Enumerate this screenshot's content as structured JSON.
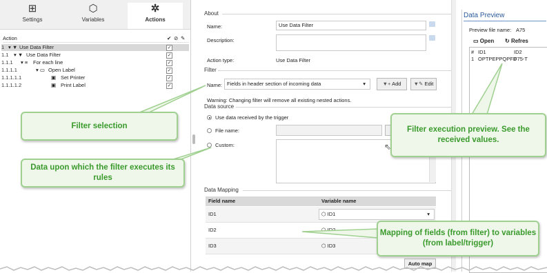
{
  "tabs": {
    "settings": "Settings",
    "variables": "Variables",
    "actions": "Actions"
  },
  "tree": {
    "header": "Action",
    "header_icons": [
      "✔",
      "⊘",
      "✎"
    ],
    "rows": [
      {
        "num": "1",
        "label": "Use Data Filter",
        "icon": "filter-icon",
        "checked": true
      },
      {
        "num": "1.1",
        "label": "Use Data Filter",
        "icon": "filter-icon",
        "checked": true
      },
      {
        "num": "1.1.1",
        "label": "For each line",
        "icon": "loop-icon",
        "checked": true
      },
      {
        "num": "1.1.1.1",
        "label": "Open Label",
        "icon": "open-label-icon",
        "checked": true
      },
      {
        "num": "1.1.1.1.1",
        "label": "Set Printer",
        "icon": "printer-icon",
        "checked": true
      },
      {
        "num": "1.1.1.1.2",
        "label": "Print Label",
        "icon": "printer-icon",
        "checked": true
      }
    ]
  },
  "about": {
    "section": "About",
    "name_label": "Name:",
    "name_value": "Use Data Filter",
    "description_label": "Description:",
    "description_value": "",
    "action_type_label": "Action type:",
    "action_type_value": "Use Data Filter"
  },
  "filter": {
    "section": "Filter",
    "name_label": "Name:",
    "selected": "Fields in header section of incoming data",
    "add_label": "Add",
    "edit_label": "Edit",
    "warning": "Warning: Changing filter will remove all existing nested actions."
  },
  "datasource": {
    "section": "Data source",
    "opt1": "Use data received by the trigger",
    "opt2": "File name:",
    "opt3": "Custom:"
  },
  "mapping": {
    "section": "Data Mapping",
    "col1": "Field name",
    "col2": "Variable name",
    "rows": [
      {
        "field": "ID1",
        "variable": "ID1"
      },
      {
        "field": "ID2",
        "variable": "ID2"
      },
      {
        "field": "ID3",
        "variable": "ID3"
      }
    ],
    "automap": "Auto map"
  },
  "preview": {
    "title": "Data Preview",
    "file_label": "Preview file name:",
    "file_value": "A75",
    "open_label": "Open",
    "refresh_label": "Refres",
    "col_hash": "#",
    "col_id1": "ID1",
    "col_id2": "ID2",
    "row_num": "1",
    "row_id1": "OPTPEPPQPFD",
    "row_id2": "F75-T"
  },
  "callouts": {
    "filter_selection": "Filter selection",
    "data_upon": "Data upon which the filter executes its rules",
    "preview": "Filter execution preview. See the received values.",
    "mapping": "Mapping of fields (from filter) to variables (from label/trigger)"
  },
  "colors": {
    "callout_bg": "#eef7ea",
    "callout_border": "#9fd08f",
    "callout_text": "#3a9a2c",
    "selected_row": "#d8d8d8"
  }
}
